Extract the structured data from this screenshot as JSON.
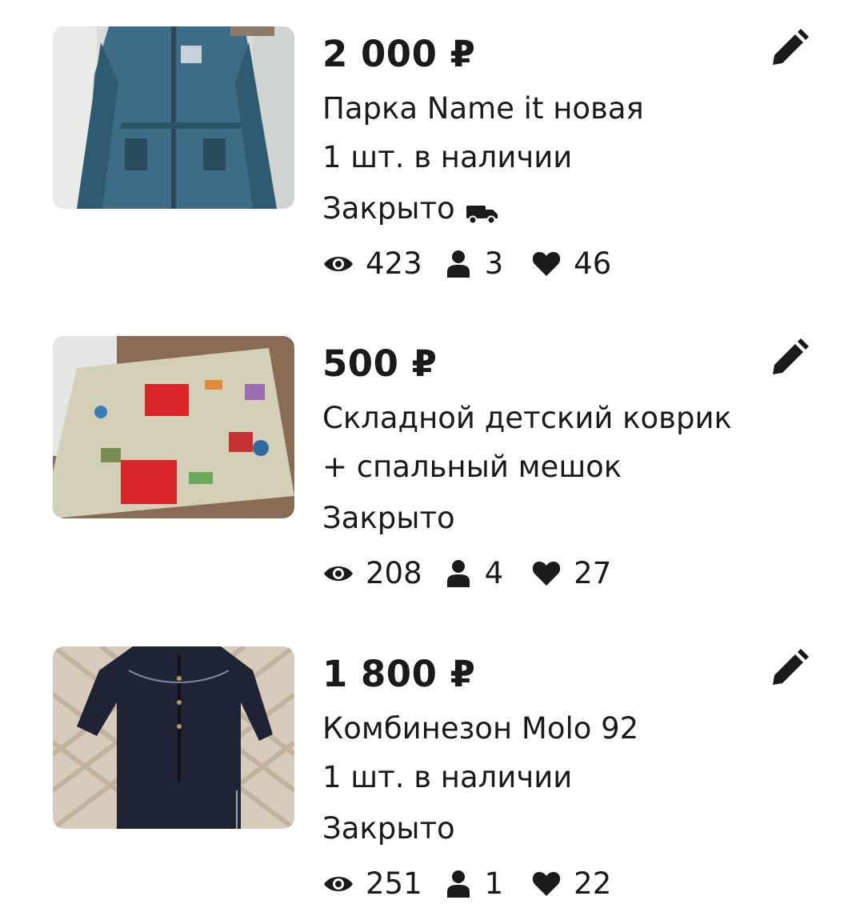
{
  "listings": [
    {
      "price": "2 000 ₽",
      "title": "Парка Name it новая",
      "stock": "1 шт. в наличии",
      "status": "Закрыто",
      "views": "423",
      "contacts": "3",
      "likes": "46",
      "icons": {
        "status": "truck-icon",
        "views": "eye-icon",
        "contacts": "person-icon",
        "likes": "heart-icon",
        "edit": "pencil-icon"
      }
    },
    {
      "price": "500 ₽",
      "title_line1": "Складной детский коврик",
      "title_line2": "+ спальный мешок",
      "status": "Закрыто",
      "views": "208",
      "contacts": "4",
      "likes": "27",
      "icons": {
        "views": "eye-icon",
        "contacts": "person-icon",
        "likes": "heart-icon",
        "edit": "pencil-icon"
      }
    },
    {
      "price": "1 800 ₽",
      "title": "Комбинезон Molo 92",
      "stock": "1 шт. в наличии",
      "status": "Закрыто",
      "views": "251",
      "contacts": "1",
      "likes": "22",
      "icons": {
        "views": "eye-icon",
        "contacts": "person-icon",
        "likes": "heart-icon",
        "edit": "pencil-icon"
      }
    }
  ],
  "colors": {
    "text": "#1a1a1a",
    "background": "#ffffff"
  }
}
